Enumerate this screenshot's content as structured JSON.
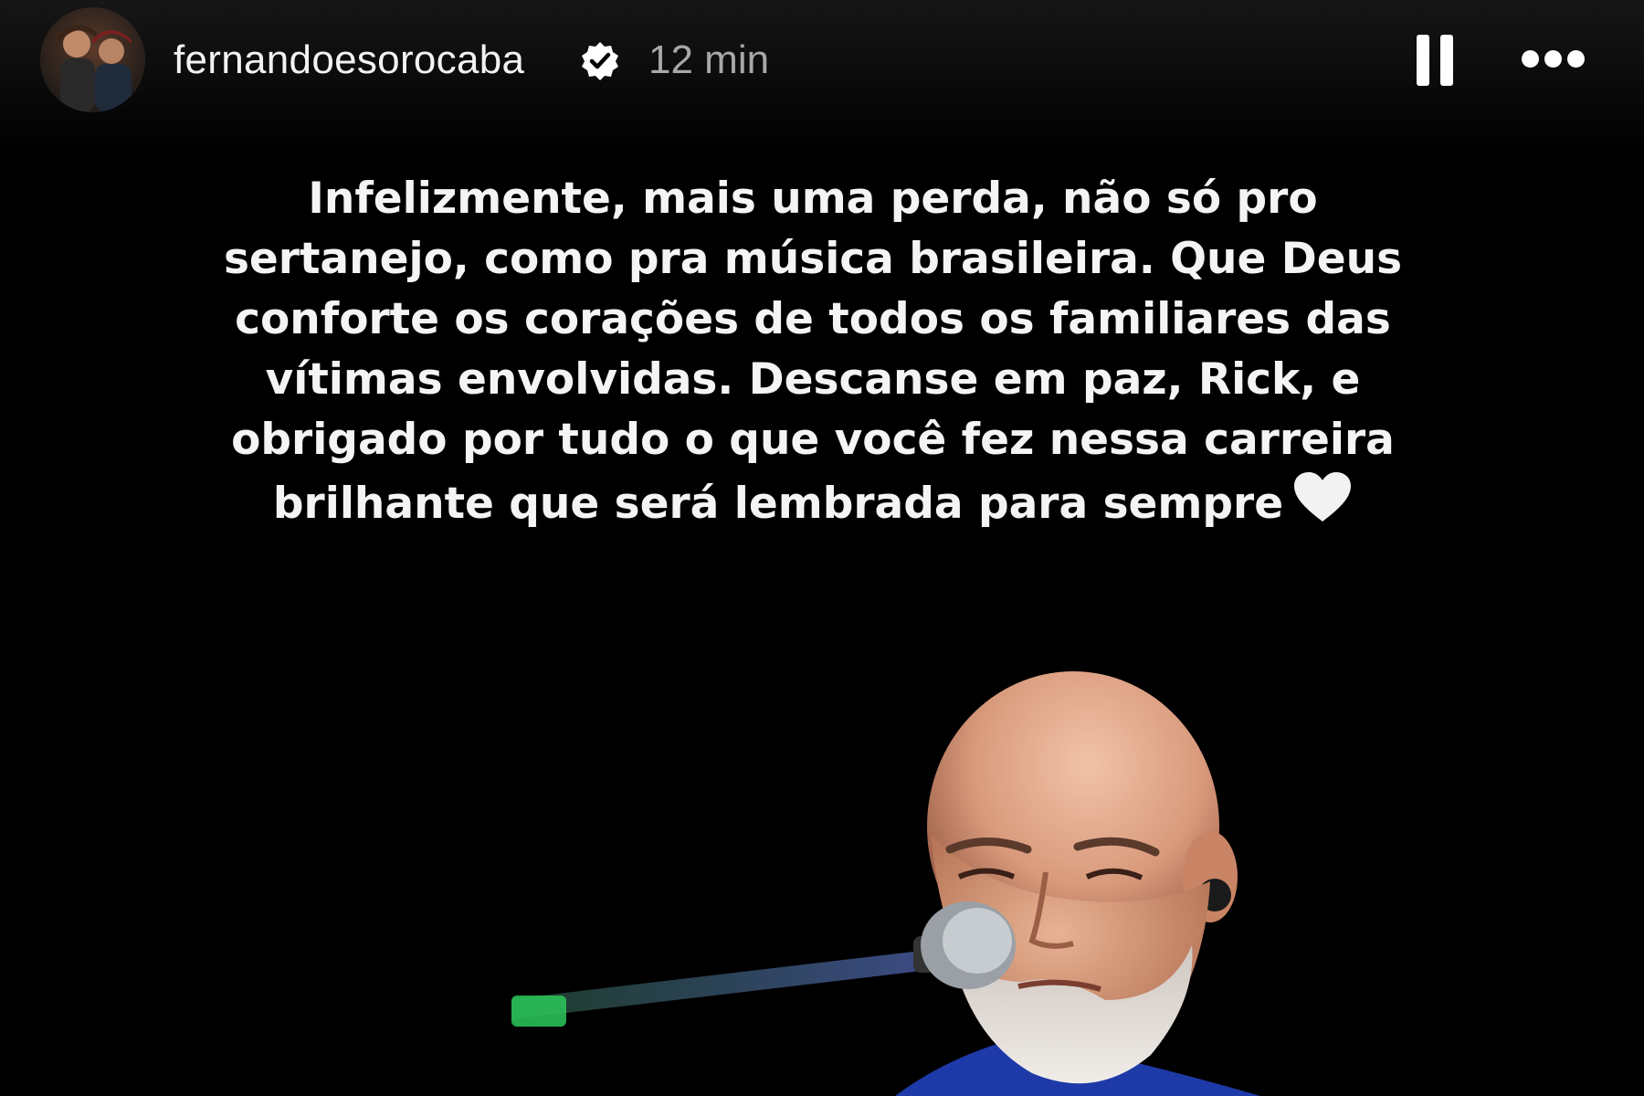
{
  "header": {
    "username": "fernandoesorocaba",
    "verified": true,
    "timestamp": "12 min",
    "pause_icon": "pause-icon",
    "more_icon": "more-horizontal-icon",
    "verified_icon": "verified-badge-icon"
  },
  "story": {
    "text": "Infelizmente, mais uma perda, não só pro sertanejo, como pra música brasileira. Que Deus conforte os corações de todos os familiares das vítimas envolvidas. Descanse em paz, Rick, e obrigado por tudo o que você fez nessa carreira brilhante que será lembrada para sempre",
    "emoji_icon": "white-heart-icon"
  },
  "colors": {
    "background": "#000000",
    "text": "#f4f4f4",
    "timestamp": "#a8a8a8"
  }
}
